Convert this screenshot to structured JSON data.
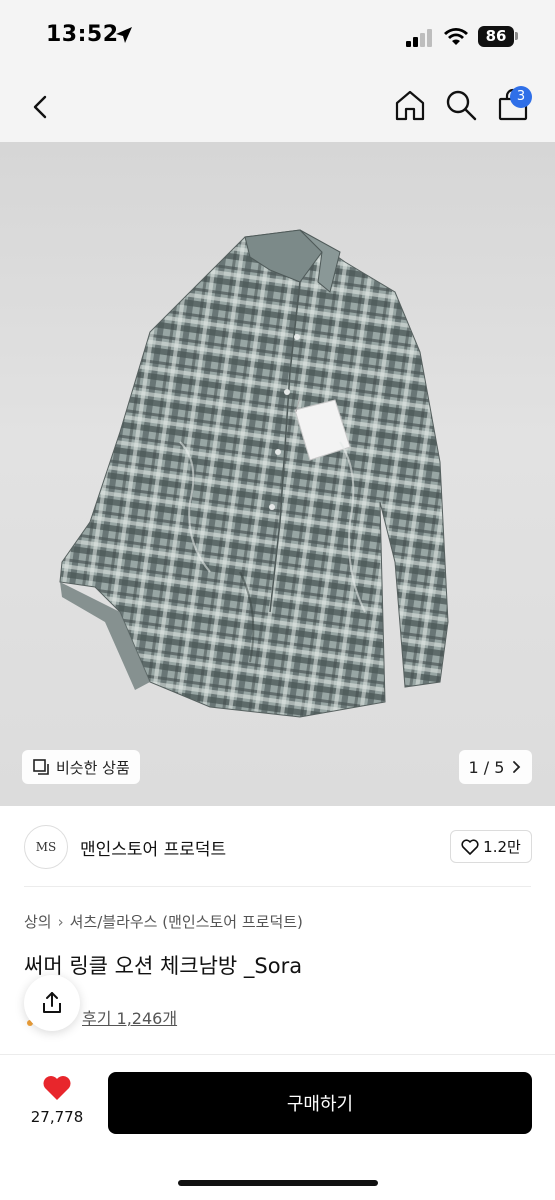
{
  "status_bar": {
    "time": "13:52",
    "battery": "86",
    "icons": [
      "location-arrow-icon",
      "signal-icon",
      "wifi-icon",
      "battery-icon"
    ]
  },
  "header": {
    "icons": [
      "back-icon",
      "home-icon",
      "search-icon",
      "cart-icon"
    ],
    "cart_count": "3"
  },
  "gallery": {
    "similar_label": "비슷한 상품",
    "pager": "1 / 5",
    "colors": {
      "shirt_base": "#7d8d8c",
      "shirt_light": "#c8d0ce",
      "shirt_dark": "#3f4a4a"
    }
  },
  "brand": {
    "logo_text": "MS",
    "name": "맨인스토어 프로덕트",
    "likes": "1.2만"
  },
  "product": {
    "breadcrumb": [
      "상의",
      "셔츠/블라우스 (맨인스토어 프로덕트)"
    ],
    "title": "써머 링클 오션 체크남방 _Sora",
    "reviews": "후기 1,246개"
  },
  "bottom_bar": {
    "wish_count": "27,778",
    "buy_label": "구매하기",
    "accent_color": "#e8262c"
  }
}
